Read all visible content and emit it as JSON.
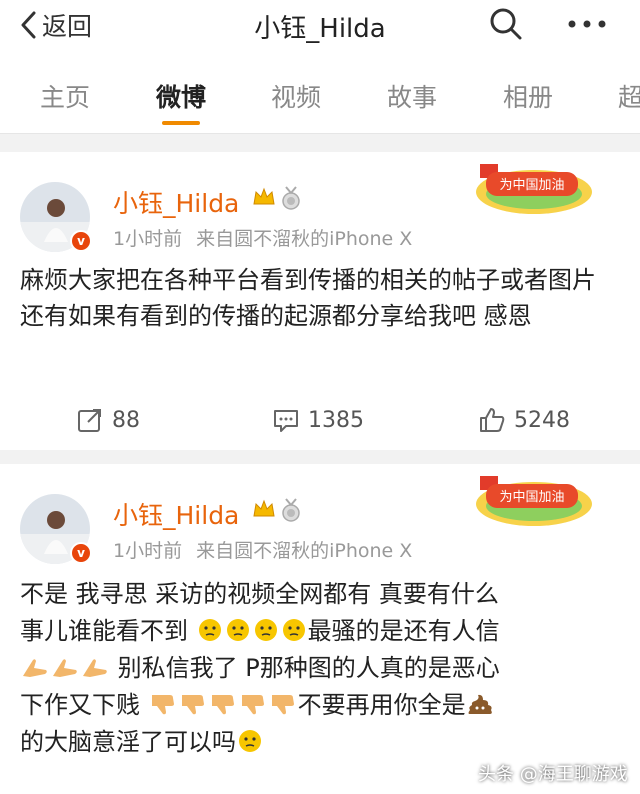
{
  "topbar": {
    "back_label": "返回",
    "title": "小钰_Hilda"
  },
  "tabs": [
    "主页",
    "微博",
    "视频",
    "故事",
    "相册",
    "超"
  ],
  "badge_text": "为中国加油",
  "posts": [
    {
      "user": "小钰_Hilda",
      "time": "1小时前",
      "source": "来自圆不溜秋的iPhone X",
      "text": "麻烦大家把在各种平台看到传播的相关的帖子或者图片 还有如果有看到的传播的起源都分享给我吧 感恩",
      "reposts": "88",
      "comments": "1385",
      "likes": "5248"
    },
    {
      "user": "小钰_Hilda",
      "time": "1小时前",
      "source": "来自圆不溜秋的iPhone X",
      "lines": [
        "不是 我寻思 采访的视频全网都有 真要有什么",
        "事儿谁能看不到",
        "最骚的是还有人信",
        "别私信我了 P那种图的人真的是恶心",
        "下作又下贱",
        "不要再用你全是",
        "的大脑意淫了可以吗"
      ]
    }
  ],
  "watermark": "头条 @海王聊游戏",
  "icons": [
    "back-chevron-icon",
    "search-icon",
    "more-icon",
    "crown-icon",
    "medal-icon",
    "repost-icon",
    "comment-icon",
    "like-icon",
    "thinking-face-icon",
    "hands-icon",
    "thumbs-down-icon",
    "poop-icon"
  ],
  "colors": {
    "accent": "#f08a00",
    "username": "#e8640c",
    "badge_bg": "#ffe066"
  }
}
